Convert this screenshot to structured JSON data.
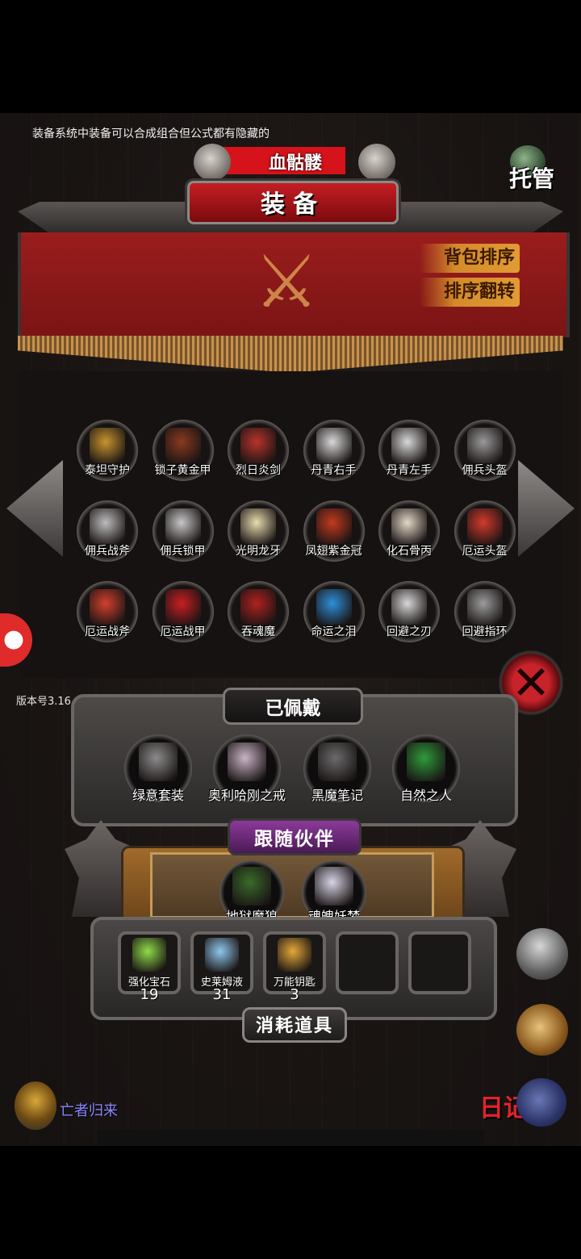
{
  "hint_text": "装备系统中装备可以合成组合但公式都有隐藏的",
  "boss": {
    "name": "血骷髅"
  },
  "auto_button": {
    "label": "托管"
  },
  "panel_title": "装备",
  "sort_buttons": {
    "sort_bag": "背包排序",
    "reverse_sort": "排序翻转"
  },
  "inventory": [
    {
      "name": "泰坦守护",
      "color": "#c9952f"
    },
    {
      "name": "锁子黄金甲",
      "color": "#8a3a1f"
    },
    {
      "name": "烈日炎剑",
      "color": "#b8342a"
    },
    {
      "name": "丹青右手",
      "color": "#d9d9d9"
    },
    {
      "name": "丹青左手",
      "color": "#d9d9d9"
    },
    {
      "name": "佣兵头盔",
      "color": "#9a9a9a"
    },
    {
      "name": "佣兵战斧",
      "color": "#bdbdbd"
    },
    {
      "name": "佣兵锁甲",
      "color": "#c7c7c7"
    },
    {
      "name": "光明龙牙",
      "color": "#e8dcae"
    },
    {
      "name": "凤翅紫金冠",
      "color": "#c23a1e"
    },
    {
      "name": "化石骨丙",
      "color": "#e4d8c6"
    },
    {
      "name": "厄运头盔",
      "color": "#d33a2b"
    },
    {
      "name": "厄运战斧",
      "color": "#d2402d"
    },
    {
      "name": "厄运战甲",
      "color": "#c81f22"
    },
    {
      "name": "吞魂魔",
      "color": "#b0221f"
    },
    {
      "name": "命运之泪",
      "color": "#2e8fd9"
    },
    {
      "name": "回避之刃",
      "color": "#d8d8d8"
    },
    {
      "name": "回避指环",
      "color": "#9d9d9d"
    }
  ],
  "close_icon": "✕",
  "version": "版本号3.16",
  "equipped": {
    "title": "已佩戴",
    "items": [
      {
        "name": "绿意套装",
        "color": "#8c8c8c"
      },
      {
        "name": "奥利哈刚之戒",
        "color": "#c9b4c7"
      },
      {
        "name": "黑魔笔记",
        "color": "#6b6b6b"
      },
      {
        "name": "自然之人",
        "color": "#2e9b3a"
      }
    ]
  },
  "partners": {
    "title": "跟随伙伴",
    "items": [
      {
        "name": "地狱魔狼",
        "color": "#3a6b2a"
      },
      {
        "name": "魂魄妖梦",
        "color": "#d7d4e6"
      }
    ]
  },
  "consumables": {
    "title": "消耗道具",
    "items": [
      {
        "name": "强化宝石",
        "count": "19",
        "color": "#8fdc4a"
      },
      {
        "name": "史莱姆液",
        "count": "31",
        "color": "#8fc8ec"
      },
      {
        "name": "万能钥匙",
        "count": "3",
        "color": "#e5a83a"
      }
    ],
    "empty_slots": 2
  },
  "diary": {
    "label": "日记"
  },
  "player": {
    "name": "亡者归来"
  }
}
